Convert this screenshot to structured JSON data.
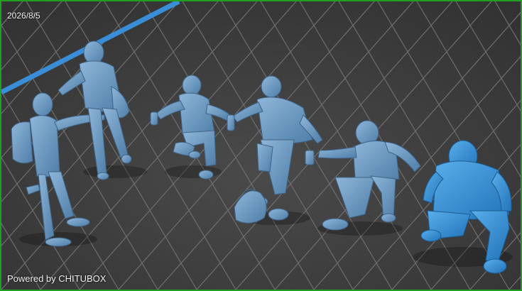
{
  "viewport": {
    "date_stamp": "2026/8/5",
    "watermark": "Powered by CHITUBOX",
    "frame_color": "#1fa01f",
    "grid_line_color": "#6e6e6e",
    "floor_color": "#3a3a3a",
    "axis_color": "#3a8ed8",
    "model_color": "#6d9ec9",
    "selected_model_color": "#3d93d6"
  },
  "models": [
    {
      "name": "standing-boy-with-backpack",
      "selected": false
    },
    {
      "name": "walking-person-with-bag",
      "selected": false
    },
    {
      "name": "kneeling-figure-with-spray-can",
      "selected": false
    },
    {
      "name": "crouching-figure-reaching",
      "selected": false
    },
    {
      "name": "backpack-on-ground",
      "selected": false
    },
    {
      "name": "kneeling-figure-with-hood",
      "selected": false
    },
    {
      "name": "crouching-figure-hoodie",
      "selected": true
    }
  ]
}
